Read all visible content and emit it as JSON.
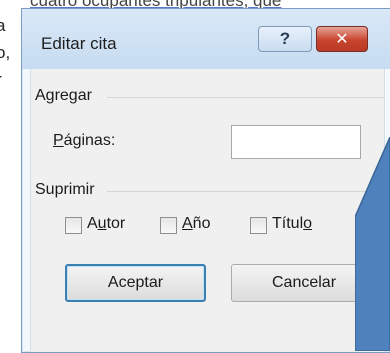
{
  "background_document": {
    "lines": [
      ",",
      "a",
      "o,",
      "r"
    ],
    "top_text": "cuatro ocupantes tripulantes, que"
  },
  "dialog": {
    "title": "Editar cita",
    "help_glyph": "?",
    "close_glyph": "✕",
    "agregar": {
      "group_label": "Agregar",
      "pages_label": "Páginas:",
      "pages_label_access_key": "P",
      "pages_label_rest": "áginas:",
      "pages_value": ""
    },
    "suprimir": {
      "group_label": "Suprimir",
      "checkboxes": [
        {
          "pre": "A",
          "key": "u",
          "post": "tor",
          "checked": false
        },
        {
          "pre": "",
          "key": "A",
          "post": "ño",
          "checked": false
        },
        {
          "pre": "Títul",
          "key": "o",
          "post": "",
          "checked": false
        }
      ]
    },
    "buttons": {
      "accept": "Aceptar",
      "cancel": "Cancelar"
    }
  },
  "colors": {
    "callout_fill": "#4f81bd",
    "close_button": "#c9442e",
    "default_button_border": "#3c7fb1"
  }
}
